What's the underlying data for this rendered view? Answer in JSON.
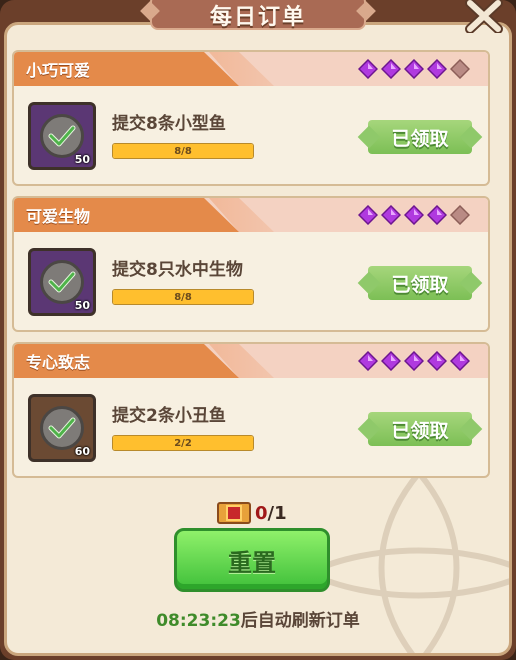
{
  "window": {
    "title": "每日订单",
    "close_icon": "close-x-icon"
  },
  "orders": [
    {
      "category": "小巧可爱",
      "gems_filled": 4,
      "gems_total": 5,
      "task": "提交8条小型鱼",
      "progress_text": "8/8",
      "progress_fraction": 1.0,
      "item_count": "50",
      "item_frame_color": "#5b3774",
      "status_label": "已领取"
    },
    {
      "category": "可爱生物",
      "gems_filled": 4,
      "gems_total": 5,
      "task": "提交8只水中生物",
      "progress_text": "8/8",
      "progress_fraction": 1.0,
      "item_count": "50",
      "item_frame_color": "#5b3774",
      "status_label": "已领取"
    },
    {
      "category": "专心致志",
      "gems_filled": 5,
      "gems_total": 5,
      "task": "提交2条小丑鱼",
      "progress_text": "2/2",
      "progress_fraction": 1.0,
      "item_count": "60",
      "item_frame_color": "#6b4a33",
      "status_label": "已领取"
    }
  ],
  "reset": {
    "cost_used": "0",
    "cost_total": "1",
    "button_label": "重置",
    "ticket_icon": "reset-ticket-icon"
  },
  "refresh": {
    "time": "08:23:23",
    "suffix": "后自动刷新订单"
  },
  "colors": {
    "gem_filled": "#b03adf",
    "gem_empty": "#b98a84",
    "accent_orange": "#e48a4a",
    "claimed_green": "#7cbf55"
  }
}
